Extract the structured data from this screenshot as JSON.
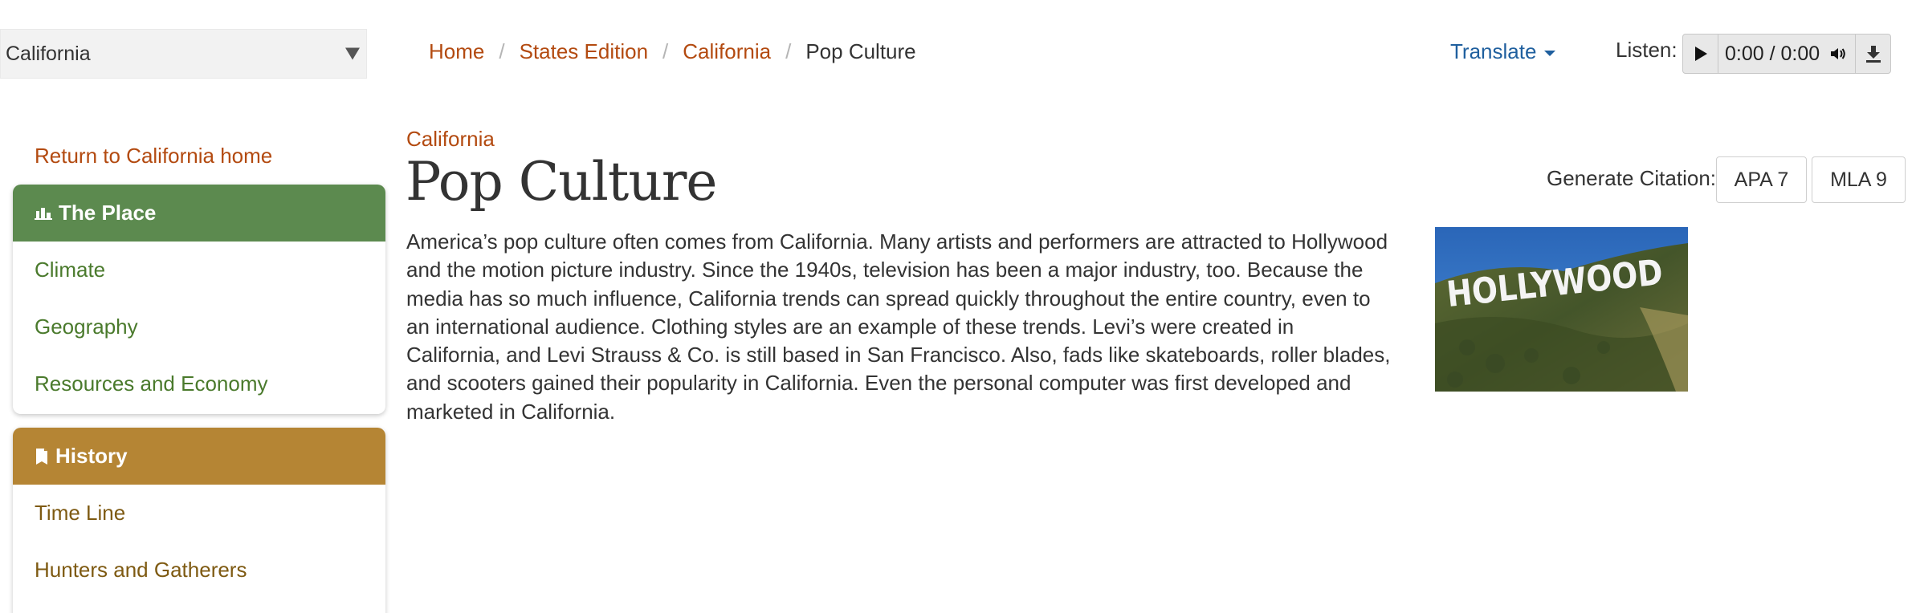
{
  "state_select": {
    "value": "California"
  },
  "breadcrumb": [
    {
      "label": "Home"
    },
    {
      "label": "States Edition"
    },
    {
      "label": "California"
    },
    {
      "label": "Pop Culture"
    }
  ],
  "breadcrumb_sep": "/",
  "translate": {
    "label": "Translate"
  },
  "listen": {
    "label": "Listen:",
    "time": "0:00 / 0:00"
  },
  "sidebar": {
    "return_link": "Return to California home",
    "place": {
      "title": "The Place",
      "items": [
        "Climate",
        "Geography",
        "Resources and Economy"
      ]
    },
    "history": {
      "title": "History",
      "items": [
        "Time Line",
        "Hunters and Gatherers"
      ]
    }
  },
  "main": {
    "kicker": "California",
    "title": "Pop Culture",
    "citation": {
      "label": "Generate Citation:",
      "apa": "APA 7",
      "mla": "MLA 9"
    },
    "body": "America’s pop culture often comes from California. Many artists and performers are attracted to Hollywood and the motion picture industry. Since the 1940s, television has been a major industry, too. Because the media has so much influence, California trends can spread quickly throughout the entire country, even to an international audience. Clothing styles are an example of these trends. Levi’s were created in California, and Levi Strauss & Co. is still based in San Francisco. Also, fads like skateboards, roller blades, and scooters gained their popularity in California. Even the personal computer was first developed and marketed in California.",
    "image_sign_text": "HOLLYWOOD"
  },
  "colors": {
    "link_orange": "#b34a10",
    "place_green": "#5c8a4f",
    "history_gold": "#b58534",
    "translate_blue": "#1f5f9e"
  }
}
